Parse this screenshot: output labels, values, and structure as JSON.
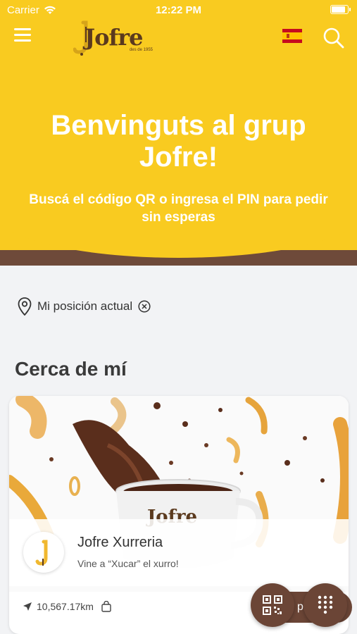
{
  "status_bar": {
    "carrier": "Carrier",
    "time": "12:22 PM",
    "battery_level": 0.95
  },
  "header": {
    "logo_text": "Jofre",
    "logo_subtext": "des de 1955",
    "language_flag": "flag-spain-icon",
    "menu_icon": "hamburger-menu-icon",
    "search_icon": "search-icon"
  },
  "hero": {
    "title": "Benvinguts al grup Jofre!",
    "subtitle": "Buscá el código QR o ingresa el PIN para pedir sin esperas"
  },
  "location": {
    "label": "Mi posición actual",
    "icon": "location-pin-icon",
    "clear_icon": "close-circle-icon"
  },
  "nearby": {
    "title": "Cerca de mí",
    "card": {
      "name": "Jofre Xurreria",
      "tagline": "Vine a “Xucar” el xurro!",
      "avatar_letter": "J",
      "distance": "10,567.17km",
      "order_label": "pidi",
      "image_cup_text": "Jofre"
    }
  },
  "fabs": {
    "qr_icon": "qr-code-icon",
    "pin_icon": "keypad-icon"
  },
  "colors": {
    "brand_yellow": "#f9cb20",
    "brand_brown": "#6b4536"
  }
}
